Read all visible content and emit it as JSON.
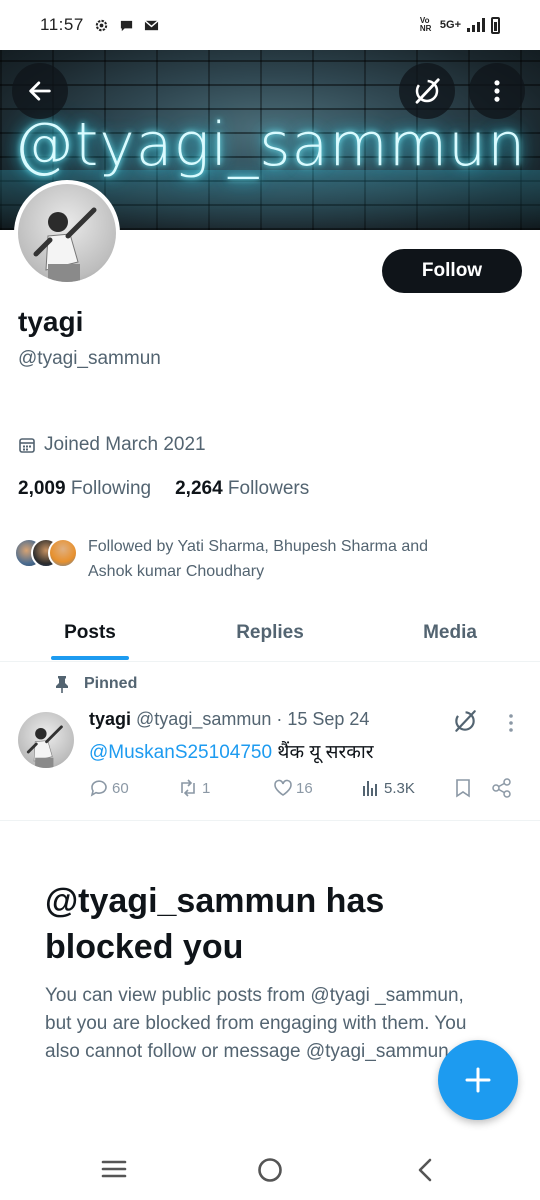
{
  "status_bar": {
    "time": "11:57",
    "network": "5G+",
    "volte": "Vo NR"
  },
  "banner": {
    "text": "@tyagi_sammun"
  },
  "profile": {
    "display_name": "tyagi",
    "handle": "@tyagi_sammun",
    "follow_label": "Follow",
    "joined": "Joined March 2021",
    "following_count": "2,009",
    "following_label": "Following",
    "followers_count": "2,264",
    "followers_label": "Followers",
    "followed_by_line1": "Followed by Yati Sharma, Bhupesh Sharma and",
    "followed_by_line2": "Ashok kumar Choudhary"
  },
  "tabs": [
    {
      "label": "Posts",
      "active": true
    },
    {
      "label": "Replies",
      "active": false
    },
    {
      "label": "Media",
      "active": false
    }
  ],
  "pinned_post": {
    "pinned_label": "Pinned",
    "author_name": "tyagi",
    "author_handle": "@tyagi_sammun",
    "date": "· 15 Sep 24",
    "mention": "@MuskanS25104750",
    "text": " थैंक यू सरकार",
    "replies": "60",
    "reposts": "1",
    "likes": "16",
    "views": "5.3K"
  },
  "blocked": {
    "title": "@tyagi_sammun has blocked you",
    "body": "You can view public posts from @tyagi _sammun, but you are blocked from engaging with them. You also cannot follow or message @tyagi_sammun."
  },
  "colors": {
    "accent": "#1d9bf0",
    "text_primary": "#0f1419",
    "text_secondary": "#536471",
    "follow_bg": "#0f1419"
  },
  "icons": [
    "back-arrow-icon",
    "grok-icon",
    "more-vertical-icon",
    "calendar-icon",
    "pin-icon",
    "reply-icon",
    "repost-icon",
    "like-icon",
    "views-icon",
    "bookmark-icon",
    "share-icon",
    "plus-icon",
    "recents-icon",
    "home-icon",
    "back-nav-icon"
  ]
}
